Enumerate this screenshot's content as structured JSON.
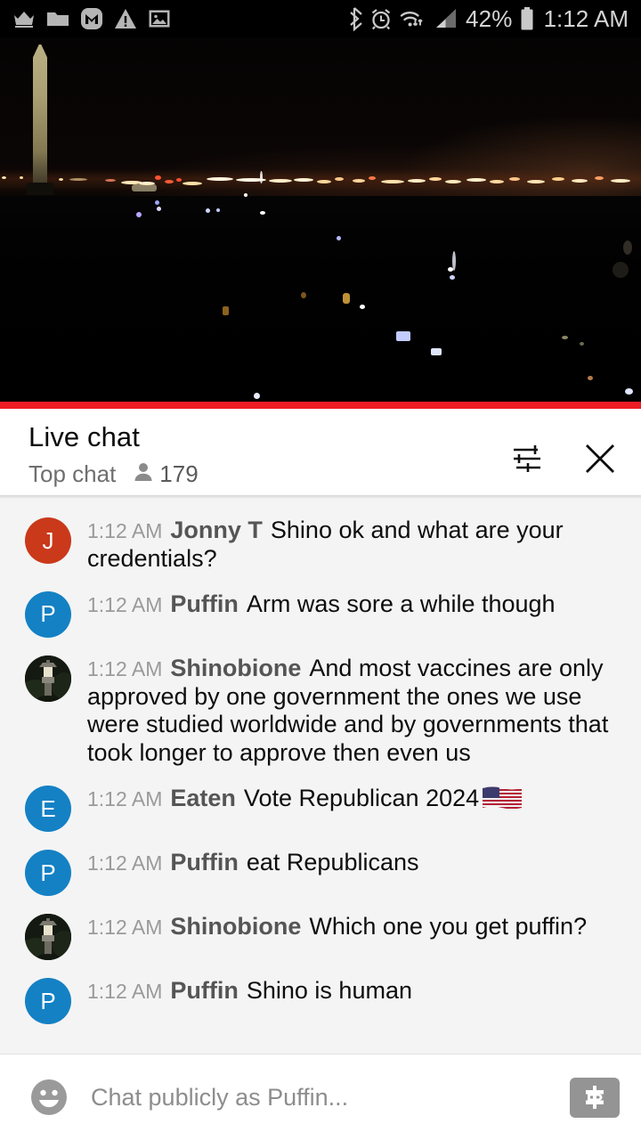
{
  "status_bar": {
    "left_icons": [
      "crown-icon",
      "folder-icon",
      "gmail-icon",
      "warning-triangle-icon",
      "image-icon"
    ],
    "right_icons": [
      "bluetooth-icon",
      "alarm-clock-icon",
      "wifi-icon",
      "cellular-signal-icon"
    ],
    "battery_percent": "42%",
    "battery_icon": "battery-icon",
    "clock": "1:12 AM"
  },
  "video": {
    "scene": "night-cityscape-washington-monument",
    "progress_color": "#ed1c24"
  },
  "chat": {
    "title": "Live chat",
    "mode_label": "Top chat",
    "viewer_count": "179",
    "viewer_icon": "person-icon",
    "settings_icon": "tune-sliders-icon",
    "close_icon": "close-x-icon",
    "messages": [
      {
        "time": "1:12 AM",
        "author": "Jonny T",
        "text": "Shino ok and what are your credentials?",
        "avatar_letter": "J",
        "avatar_color": "#c9391a",
        "avatar_type": "letter"
      },
      {
        "time": "1:12 AM",
        "author": "Puffin",
        "text": "Arm was sore a while though",
        "avatar_letter": "P",
        "avatar_color": "#1481c4",
        "avatar_type": "letter"
      },
      {
        "time": "1:12 AM",
        "author": "Shinobione",
        "text": "And most vaccines are only approved by one government the ones we use were studied worldwide and by governments that took longer to approve then even us",
        "avatar_letter": "",
        "avatar_color": "#171c14",
        "avatar_type": "photo"
      },
      {
        "time": "1:12 AM",
        "author": "Eaten",
        "text": "Vote Republican 2024",
        "emoji": "us-flag-emoji",
        "avatar_letter": "E",
        "avatar_color": "#1481c4",
        "avatar_type": "letter"
      },
      {
        "time": "1:12 AM",
        "author": "Puffin",
        "text": "eat Republicans",
        "avatar_letter": "P",
        "avatar_color": "#1481c4",
        "avatar_type": "letter"
      },
      {
        "time": "1:12 AM",
        "author": "Shinobione",
        "text": "Which one you get puffin?",
        "avatar_letter": "",
        "avatar_color": "#171c14",
        "avatar_type": "photo"
      },
      {
        "time": "1:12 AM",
        "author": "Puffin",
        "text": "Shino is human",
        "avatar_letter": "P",
        "avatar_color": "#1481c4",
        "avatar_type": "letter"
      }
    ],
    "input": {
      "placeholder": "Chat publicly as Puffin...",
      "value": "",
      "emoji_icon": "emoji-smiley-icon",
      "superchat_icon": "dollar-superchat-icon"
    }
  }
}
